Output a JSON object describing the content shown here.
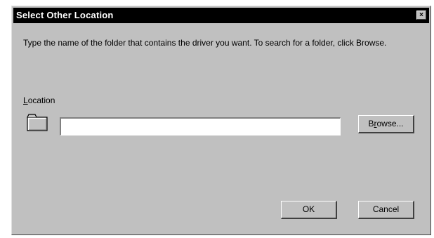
{
  "window": {
    "title": "Select Other Location",
    "close_glyph": "×"
  },
  "instructions": "Type the name of the folder that contains the driver you want. To search for a folder, click Browse.",
  "location": {
    "label_accel": "L",
    "label_rest": "ocation",
    "value": "",
    "icon": "folder-icon"
  },
  "buttons": {
    "browse_pre": "B",
    "browse_accel": "r",
    "browse_post": "owse...",
    "ok": "OK",
    "cancel": "Cancel"
  },
  "colors": {
    "dialog_bg": "#c0c0c0",
    "titlebar_bg": "#000000",
    "title_text": "#ffffff"
  }
}
